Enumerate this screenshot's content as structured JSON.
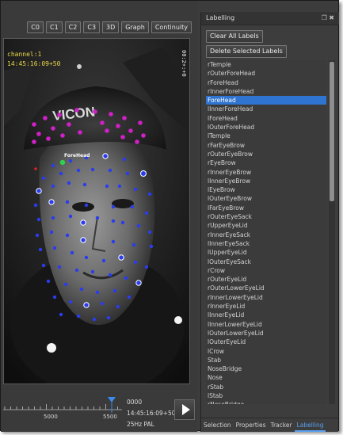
{
  "view_buttons": [
    "C0",
    "C1",
    "C2",
    "C3",
    "3D",
    "Graph",
    "Continuity"
  ],
  "viewport": {
    "channel": "channel:1",
    "timecode": "14:45:16:09+50",
    "vertical_text": "00:2+:+0",
    "face_label": "ForeHead"
  },
  "timeline": {
    "tick_labels": [
      "5000",
      "5500"
    ],
    "frame": "0000",
    "timecode": "14:45:16:09+50",
    "rate": "25Hz PAL"
  },
  "panel": {
    "title": "Labelling",
    "title_icons": "❐ ✖",
    "clear_all": "Clear All Labels",
    "delete_selected": "Delete Selected Labels",
    "selected_index": 4,
    "labels": [
      "rTemple",
      "rOuterForeHead",
      "rForeHead",
      "rInnerForeHead",
      "ForeHead",
      "lInnerForeHead",
      "lForeHead",
      "lOuterForeHead",
      "lTemple",
      "rFarEyeBrow",
      "rOuterEyeBrow",
      "rEyeBrow",
      "rInnerEyeBrow",
      "lInnerEyeBrow",
      "lEyeBrow",
      "lOuterEyeBrow",
      "lFarEyeBrow",
      "rOuterEyeSack",
      "rUpperEyeLid",
      "rInnerEyeSack",
      "lInnerEyeSack",
      "lUpperEyeLid",
      "lOuterEyeSack",
      "rCrow",
      "rOuterEyeLid",
      "rOuterLowerEyeLid",
      "rInnerLowerEyeLid",
      "rInnerEyeLid",
      "lInnerEyeLid",
      "lInnerLowerEyeLid",
      "lOuterLowerEyeLid",
      "lOuterEyeLid",
      "lCrow",
      "Stab",
      "NoseBridge",
      "Nose",
      "rStab",
      "lStab",
      "rNoseBridge"
    ],
    "tabs": [
      "Selection",
      "Properties",
      "Tracker",
      "Labelling"
    ],
    "active_tab": "Labelling"
  },
  "colors": {
    "selection": "#2f74d0",
    "active_tab": "#5aa0f0",
    "marker_magenta": "#d020c8",
    "marker_blue": "#2a3cf0",
    "marker_green": "#30d050",
    "overlay_text": "#e8d84a"
  }
}
